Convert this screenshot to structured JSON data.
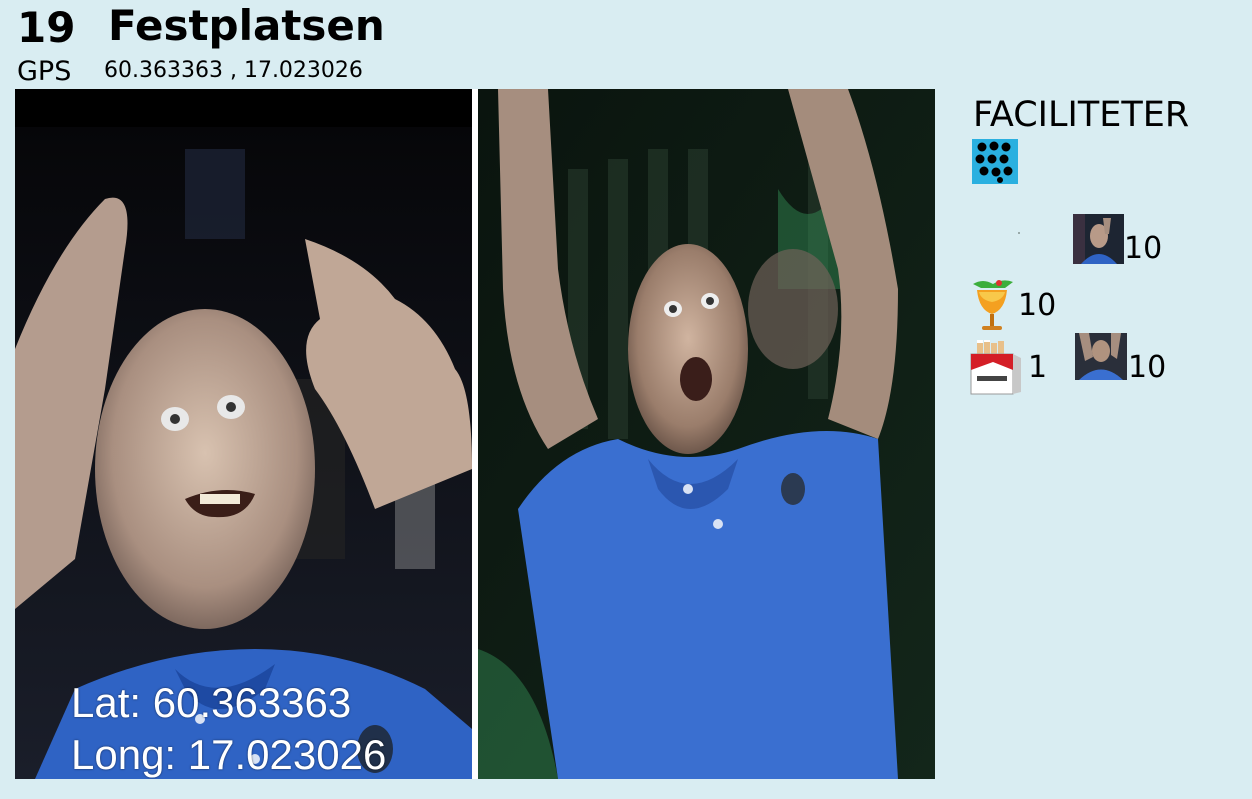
{
  "header": {
    "number": "19",
    "title": "Festplatsen",
    "gps_label": "GPS",
    "gps_value": "60.363363 , 17.023026"
  },
  "photo_overlay": {
    "lat": "Lat: 60.363363",
    "long": "Long: 17.023026"
  },
  "sidebar": {
    "title": "FACILITETER",
    "items": [
      {
        "icon": "person-photo-icon",
        "value": "10"
      },
      {
        "icon": "cocktail-icon",
        "value": "10"
      },
      {
        "icon": "cigarette-pack-icon",
        "value": "1"
      },
      {
        "icon": "person-photo-icon",
        "value": "10"
      }
    ]
  },
  "colors": {
    "background": "#d9edf2",
    "shirt_blue": "#3a6fd0",
    "icon_blue": "#2ab0e0"
  }
}
